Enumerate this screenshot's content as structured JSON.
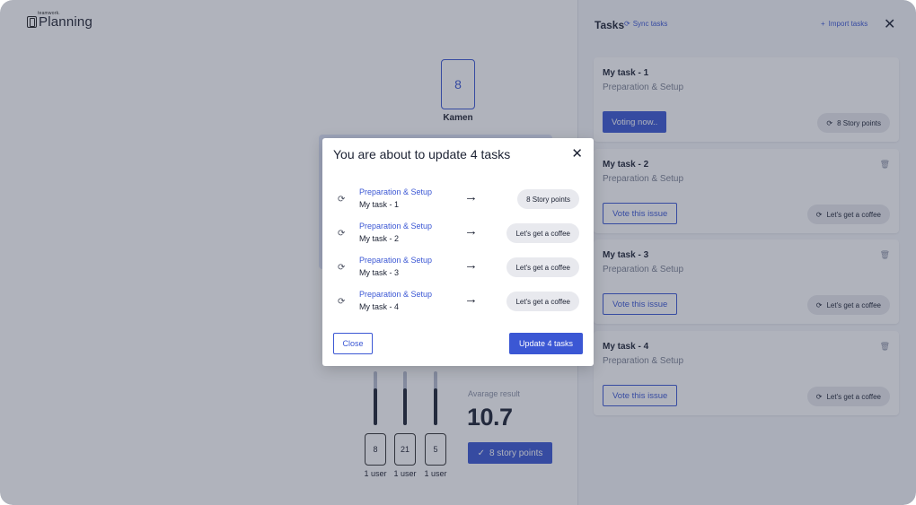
{
  "logo": {
    "small": "teamwork.",
    "main": "Planning"
  },
  "player": {
    "card_value": "8",
    "name": "Kamen"
  },
  "votes": [
    {
      "value": "8",
      "users": "1 user",
      "level": 0.68
    },
    {
      "value": "21",
      "users": "1 user",
      "level": 0.68
    },
    {
      "value": "5",
      "users": "1 user",
      "level": 0.68
    }
  ],
  "result": {
    "label": "Avarage result",
    "value": "10.7",
    "button_label": "8 story points"
  },
  "panel": {
    "title": "Tasks",
    "sync_label": "Sync tasks",
    "import_label": "Import tasks",
    "tasks": [
      {
        "name": "My task - 1",
        "category": "Preparation & Setup",
        "button": "Voting now..",
        "pill": "8 Story points"
      },
      {
        "name": "My task - 2",
        "category": "Preparation & Setup",
        "button": "Vote this issue",
        "pill": "Let's get a coffee"
      },
      {
        "name": "My task - 3",
        "category": "Preparation & Setup",
        "button": "Vote this issue",
        "pill": "Let's get a coffee"
      },
      {
        "name": "My task - 4",
        "category": "Preparation & Setup",
        "button": "Vote this issue",
        "pill": "Let's get a coffee"
      }
    ]
  },
  "modal": {
    "title": "You are about to update 4 tasks",
    "rows": [
      {
        "category": "Preparation & Setup",
        "name": "My task - 1",
        "value": "8 Story points"
      },
      {
        "category": "Preparation & Setup",
        "name": "My task - 2",
        "value": "Let's get a coffee"
      },
      {
        "category": "Preparation & Setup",
        "name": "My task - 3",
        "value": "Let's get a coffee"
      },
      {
        "category": "Preparation & Setup",
        "name": "My task - 4",
        "value": "Let's get a coffee"
      }
    ],
    "close_label": "Close",
    "update_label": "Update 4 tasks"
  },
  "icons": {
    "sync": "sync-icon",
    "plus": "plus-icon",
    "close": "close-icon",
    "trash": "trash-icon",
    "arrow": "arrow-right-icon",
    "check": "check-icon"
  },
  "colors": {
    "accent": "#3b57d4",
    "overlay": "rgba(48,56,80,0.38)"
  }
}
